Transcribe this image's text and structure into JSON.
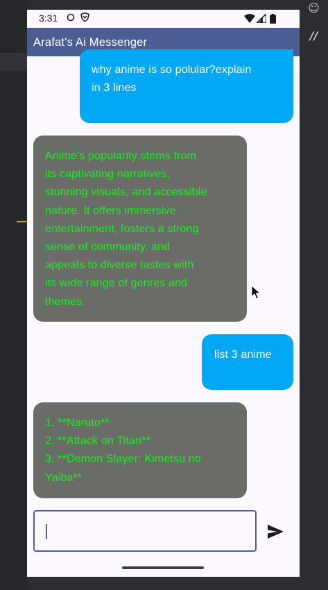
{
  "status_bar": {
    "time": "3:31"
  },
  "app_bar": {
    "title": "Arafat's Ai Messenger"
  },
  "messages": [
    {
      "role": "user",
      "lines": [
        "why anime is so polular?explain",
        "in 3 lines"
      ]
    },
    {
      "role": "bot",
      "lines": [
        "Anime's popularity stems from",
        "its captivating narratives,",
        "stunning visuals, and accessible",
        "nature. It offers immersive",
        "entertainment, fosters a strong",
        "sense of community, and",
        "appeals to diverse tastes with",
        "its wide range of genres and",
        "themes."
      ]
    },
    {
      "role": "user",
      "lines": [
        "list 3 anime"
      ]
    },
    {
      "role": "bot",
      "lines": [
        "1. **Naruto**",
        "2. **Attack on Titan**",
        "3. **Demon Slayer: Kimetsu no",
        "Yaiba**"
      ]
    }
  ],
  "composer": {
    "value": "",
    "placeholder": ""
  },
  "colors": {
    "app_bar": "#4a5e94",
    "user_bubble": "#03a8f4",
    "bot_bubble": "#6a6c68",
    "bot_text": "#19f01e",
    "background": "#fdf8fd"
  },
  "icons": [
    "shield-icon",
    "wifi-icon",
    "signal-icon",
    "battery-icon",
    "send-icon"
  ]
}
